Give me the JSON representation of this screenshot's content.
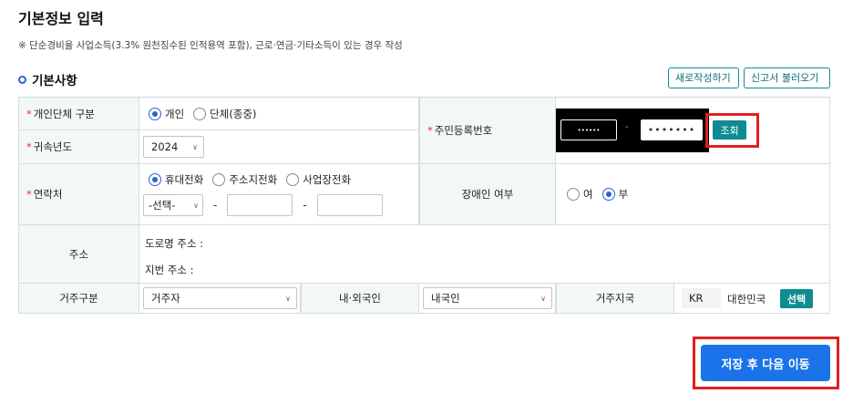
{
  "page": {
    "title": "기본정보 입력",
    "notice": "※ 단순경비율 사업소득(3.3% 원천징수된 인적용역 포함), 근로·연금·기타소득이 있는 경우 작성"
  },
  "section": {
    "title": "기본사항",
    "new_button": "새로작성하기",
    "load_button": "신고서 불러오기"
  },
  "form": {
    "person_type": {
      "label": "개인단체 구분",
      "options": [
        "개인",
        "단체(종중)"
      ],
      "selected": "개인"
    },
    "year": {
      "label": "귀속년도",
      "value": "2024"
    },
    "ssn": {
      "label": "주민등록번호",
      "front_value": "••••••",
      "separator": "-",
      "back_value": "•••••••",
      "lookup_button": "조회"
    },
    "contact": {
      "label": "연락처",
      "options": [
        "휴대전화",
        "주소지전화",
        "사업장전화"
      ],
      "selected": "휴대전화",
      "prefix_placeholder": "-선택-",
      "dash": "-"
    },
    "disability": {
      "label": "장애인 여부",
      "options": [
        "여",
        "부"
      ],
      "selected": "부"
    },
    "address": {
      "label": "주소",
      "road_label": "도로명 주소 :",
      "lot_label": "지번 주소 :"
    },
    "residence_type": {
      "label": "거주구분",
      "value": "거주자"
    },
    "nationality": {
      "label": "내·외국인",
      "value": "내국인"
    },
    "residence_country": {
      "label": "거주지국",
      "code": "KR",
      "name": "대한민국",
      "select_button": "선택"
    }
  },
  "footer": {
    "save_button": "저장 후 다음 이동"
  },
  "colors": {
    "primary_blue": "#1a73e8",
    "teal_button": "#0e8c93",
    "radio_blue": "#2a64c8",
    "label_bg": "#f2f8f8",
    "highlight_red": "#e02020",
    "required_red": "#e03131"
  }
}
